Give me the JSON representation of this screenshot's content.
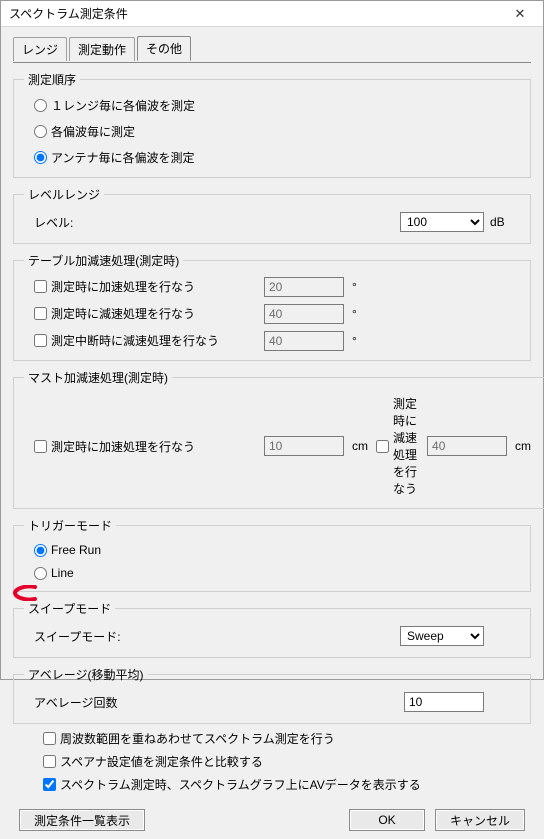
{
  "window": {
    "title": "スペクトラム測定条件"
  },
  "tabs": {
    "range": "レンジ",
    "action": "測定動作",
    "other": "その他"
  },
  "groups": {
    "order": {
      "legend": "測定順序",
      "opt1": "１レンジ毎に各偏波を測定",
      "opt2": "各偏波毎に測定",
      "opt3": "アンテナ毎に各偏波を測定"
    },
    "level": {
      "legend": "レベルレンジ",
      "label": "レベル:",
      "value": "100",
      "unit": "dB"
    },
    "tableAccel": {
      "legend": "テーブル加減速処理(測定時)",
      "chk1": "測定時に加速処理を行なう",
      "val1": "20",
      "unit1": "°",
      "chk2": "測定時に減速処理を行なう",
      "val2": "40",
      "unit2": "°",
      "chk3": "測定中断時に減速処理を行なう",
      "val3": "40",
      "unit3": "°"
    },
    "mastAccel": {
      "legend": "マスト加減速処理(測定時)",
      "chk1": "測定時に加速処理を行なう",
      "val1": "10",
      "unit1": "cm",
      "chk2": "測定時に減速処理を行なう",
      "val2": "40",
      "unit2": "cm"
    },
    "trigger": {
      "legend": "トリガーモード",
      "opt1": "Free Run",
      "opt2": "Line"
    },
    "sweep": {
      "legend": "スイープモード",
      "label": "スイープモード:",
      "value": "Sweep"
    },
    "average": {
      "legend": "アベレージ(移動平均)",
      "label": "アベレージ回数",
      "value": "10"
    }
  },
  "checks": {
    "c1": "周波数範囲を重ねあわせてスペクトラム測定を行う",
    "c2": "スペアナ設定値を測定条件と比較する",
    "c3": "スペクトラム測定時、スペクトラムグラフ上にAVデータを表示する"
  },
  "buttons": {
    "list": "測定条件一覧表示",
    "ok": "OK",
    "cancel": "キャンセル"
  }
}
